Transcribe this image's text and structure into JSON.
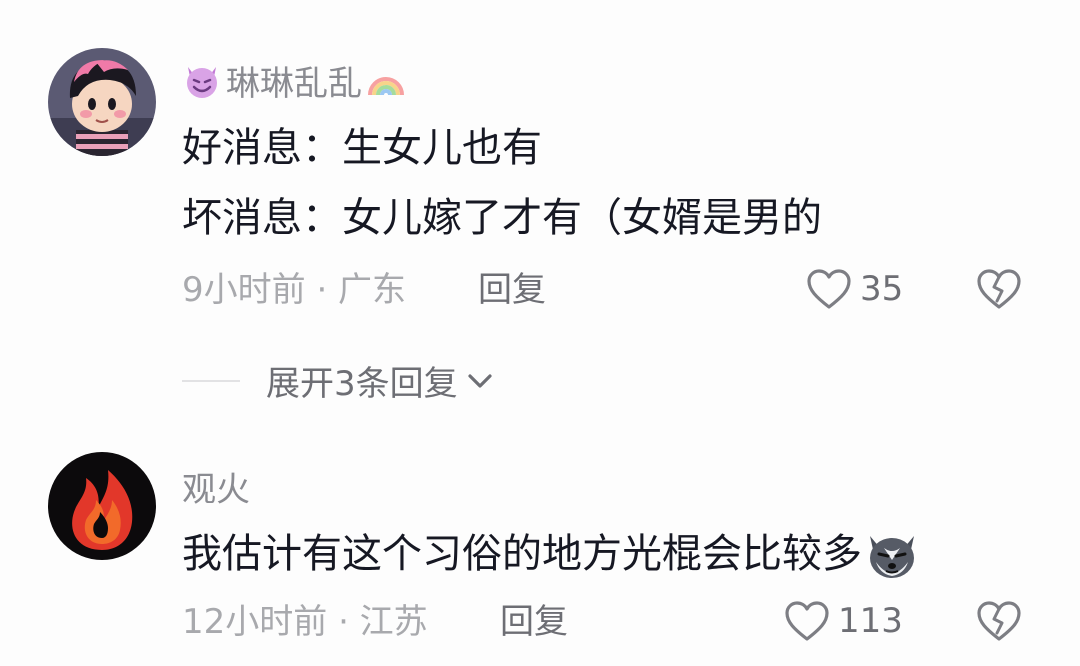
{
  "comments": [
    {
      "username": "琳琳乱乱",
      "username_prefix_emoji": "smiling-devil-icon",
      "username_suffix_emoji": "rainbow-icon",
      "lines": [
        "好消息：生女儿也有",
        "坏消息：女儿嫁了才有（女婿是男的"
      ],
      "time_location": "9小时前 · 广东",
      "reply_label": "回复",
      "like_count": "35",
      "expand_label": "展开3条回复"
    },
    {
      "username": "观火",
      "lines": [
        "我估计有这个习俗的地方光棍会比较多"
      ],
      "trailing_emoji": "husky-icon",
      "time_location": "12小时前 · 江苏",
      "reply_label": "回复",
      "like_count": "113"
    }
  ],
  "colors": {
    "background": "#fdfdfd",
    "primary_text": "#161823",
    "secondary_text": "#8a8b91",
    "meta_text": "#a8a9ad"
  }
}
